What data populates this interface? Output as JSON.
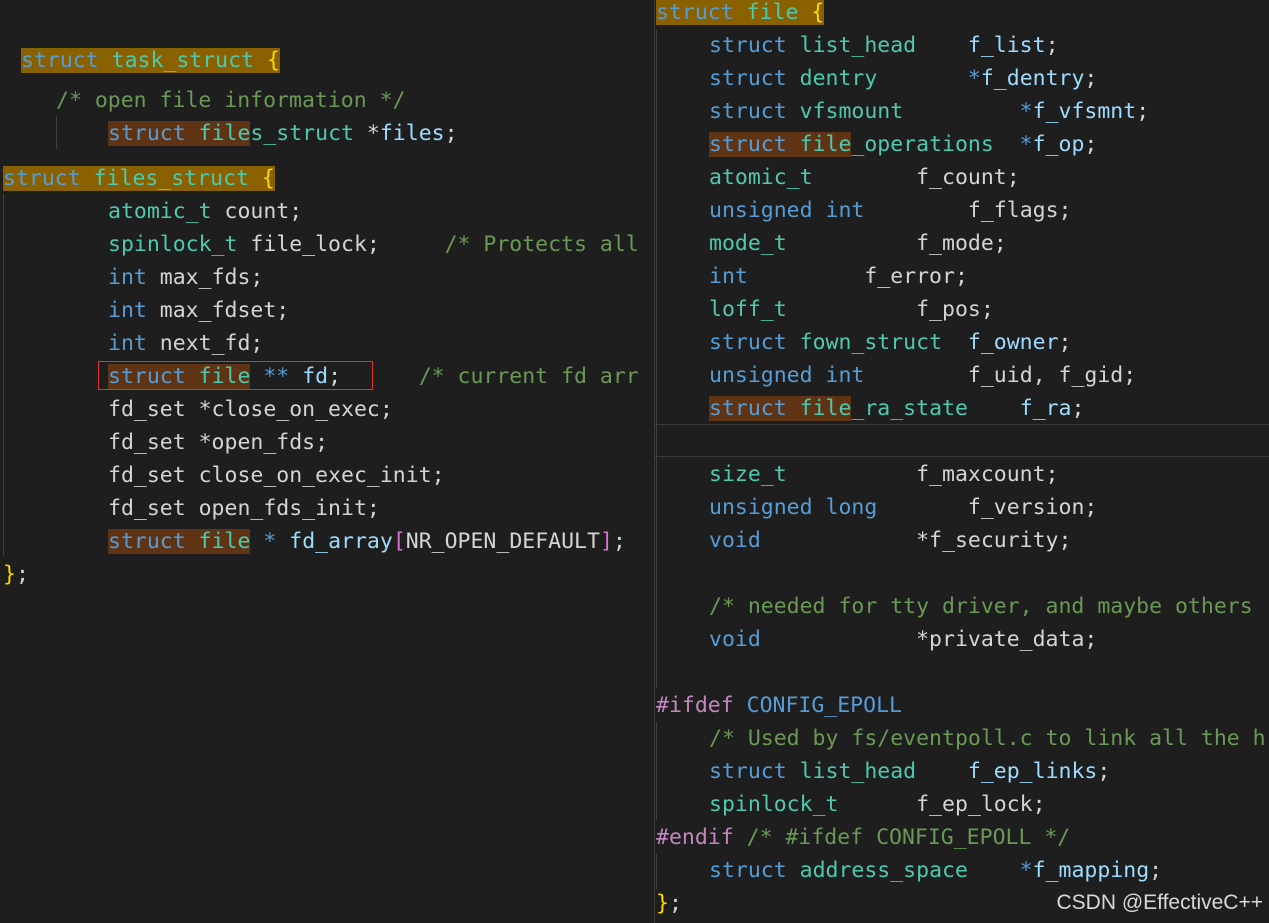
{
  "colors": {
    "background": "#1e1e1e",
    "kw": "#569cd6",
    "type": "#4ec9b0",
    "var": "#9cdcfe",
    "plain": "#d4d4d4",
    "comment": "#6a9955",
    "pre": "#c586c0",
    "brace": "#ffd700",
    "bracket": "#da70d6"
  },
  "watermark": "CSDN @EffectiveC++",
  "left_pane": {
    "lines": [
      {
        "tokens": [
          {
            "t": "struct",
            "c": "kw",
            "hl": "brace"
          },
          {
            "t": " ",
            "c": "plain",
            "hl": "brace"
          },
          {
            "t": "task_struct",
            "c": "type",
            "hl": "brace"
          },
          {
            "t": " ",
            "c": "plain",
            "hl": "brace"
          },
          {
            "t": "{",
            "c": "brace",
            "hl": "brace"
          }
        ]
      },
      {
        "tokens": [
          {
            "t": "/* open file information */",
            "c": "comment"
          }
        ]
      },
      {
        "tokens": [
          {
            "t": "struct",
            "c": "kw",
            "hl": "brown"
          },
          {
            "t": " ",
            "c": "plain",
            "hl": "brown"
          },
          {
            "t": "file",
            "c": "type",
            "hl": "brown"
          },
          {
            "t": "s_struct",
            "c": "type"
          },
          {
            "t": " *",
            "c": "plain"
          },
          {
            "t": "files",
            "c": "var"
          },
          {
            "t": ";",
            "c": "plain"
          }
        ]
      },
      {
        "tokens": [
          {
            "t": "struct",
            "c": "kw",
            "hl": "brace"
          },
          {
            "t": " ",
            "c": "plain",
            "hl": "brace"
          },
          {
            "t": "files_struct",
            "c": "type",
            "hl": "brace"
          },
          {
            "t": " ",
            "c": "plain",
            "hl": "brace"
          },
          {
            "t": "{",
            "c": "brace",
            "hl": "brace"
          }
        ]
      },
      {
        "tokens": [
          {
            "t": "atomic_t",
            "c": "type"
          },
          {
            "t": " count;",
            "c": "plain"
          }
        ]
      },
      {
        "tokens": [
          {
            "t": "spinlock_t",
            "c": "type"
          },
          {
            "t": " file_lock;     ",
            "c": "plain"
          },
          {
            "t": "/* Protects all",
            "c": "comment"
          }
        ]
      },
      {
        "tokens": [
          {
            "t": "int",
            "c": "kw"
          },
          {
            "t": " max_fds;",
            "c": "plain"
          }
        ]
      },
      {
        "tokens": [
          {
            "t": "int",
            "c": "kw"
          },
          {
            "t": " max_fdset;",
            "c": "plain"
          }
        ]
      },
      {
        "tokens": [
          {
            "t": "int",
            "c": "kw"
          },
          {
            "t": " next_fd;",
            "c": "plain"
          }
        ]
      },
      {
        "tokens": [
          {
            "t": "struct",
            "c": "kw",
            "hl": "brown"
          },
          {
            "t": " ",
            "c": "plain",
            "hl": "brown"
          },
          {
            "t": "file",
            "c": "type",
            "hl": "brown"
          },
          {
            "t": " ** ",
            "c": "kw"
          },
          {
            "t": "fd",
            "c": "var"
          },
          {
            "t": ";      ",
            "c": "plain"
          },
          {
            "t": "/* current fd arr",
            "c": "comment"
          }
        ]
      },
      {
        "tokens": [
          {
            "t": "fd_set *close_on_exec;",
            "c": "plain"
          }
        ]
      },
      {
        "tokens": [
          {
            "t": "fd_set *open_fds;",
            "c": "plain"
          }
        ]
      },
      {
        "tokens": [
          {
            "t": "fd_set close_on_exec_init;",
            "c": "plain"
          }
        ]
      },
      {
        "tokens": [
          {
            "t": "fd_set open_fds_init;",
            "c": "plain"
          }
        ]
      },
      {
        "tokens": [
          {
            "t": "struct",
            "c": "kw",
            "hl": "brown"
          },
          {
            "t": " ",
            "c": "plain",
            "hl": "brown"
          },
          {
            "t": "file",
            "c": "type",
            "hl": "brown"
          },
          {
            "t": " * ",
            "c": "kw"
          },
          {
            "t": "fd_array",
            "c": "var"
          },
          {
            "t": "[",
            "c": "bracket"
          },
          {
            "t": "NR_OPEN_DEFAULT",
            "c": "plain"
          },
          {
            "t": "]",
            "c": "bracket"
          },
          {
            "t": ";",
            "c": "plain"
          }
        ]
      },
      {
        "tokens": [
          {
            "t": "}",
            "c": "brace"
          },
          {
            "t": ";",
            "c": "plain"
          }
        ]
      }
    ]
  },
  "right_pane": {
    "lines": [
      {
        "tokens": [
          {
            "t": "struct",
            "c": "kw",
            "hl": "brace"
          },
          {
            "t": " ",
            "c": "plain",
            "hl": "brace"
          },
          {
            "t": "file",
            "c": "type",
            "hl": "brace"
          },
          {
            "t": " ",
            "c": "plain",
            "hl": "brace"
          },
          {
            "t": "{",
            "c": "brace",
            "hl": "brace"
          }
        ]
      },
      {
        "tokens": [
          {
            "t": "struct",
            "c": "kw"
          },
          {
            "t": " ",
            "c": "plain"
          },
          {
            "t": "list_head",
            "c": "type"
          },
          {
            "t": "    ",
            "c": "plain"
          },
          {
            "t": "f_list",
            "c": "var"
          },
          {
            "t": ";",
            "c": "plain"
          }
        ]
      },
      {
        "tokens": [
          {
            "t": "struct",
            "c": "kw"
          },
          {
            "t": " ",
            "c": "plain"
          },
          {
            "t": "dentry",
            "c": "type"
          },
          {
            "t": "       *",
            "c": "kw"
          },
          {
            "t": "f_dentry",
            "c": "var"
          },
          {
            "t": ";",
            "c": "plain"
          }
        ]
      },
      {
        "tokens": [
          {
            "t": "struct",
            "c": "kw"
          },
          {
            "t": " ",
            "c": "plain"
          },
          {
            "t": "vfsmount",
            "c": "type"
          },
          {
            "t": "         *",
            "c": "kw"
          },
          {
            "t": "f_vfsmnt",
            "c": "var"
          },
          {
            "t": ";",
            "c": "plain"
          }
        ]
      },
      {
        "tokens": [
          {
            "t": "struct",
            "c": "kw",
            "hl": "brown"
          },
          {
            "t": " ",
            "c": "plain",
            "hl": "brown"
          },
          {
            "t": "file",
            "c": "type",
            "hl": "brown"
          },
          {
            "t": "_operations",
            "c": "type"
          },
          {
            "t": "  *",
            "c": "kw"
          },
          {
            "t": "f_op",
            "c": "var"
          },
          {
            "t": ";",
            "c": "plain"
          }
        ]
      },
      {
        "tokens": [
          {
            "t": "atomic_t",
            "c": "type"
          },
          {
            "t": "        f_count;",
            "c": "plain"
          }
        ]
      },
      {
        "tokens": [
          {
            "t": "unsigned",
            "c": "kw"
          },
          {
            "t": " ",
            "c": "plain"
          },
          {
            "t": "int",
            "c": "kw"
          },
          {
            "t": "        f_flags;",
            "c": "plain"
          }
        ]
      },
      {
        "tokens": [
          {
            "t": "mode_t",
            "c": "type"
          },
          {
            "t": "          f_mode;",
            "c": "plain"
          }
        ]
      },
      {
        "tokens": [
          {
            "t": "int",
            "c": "kw"
          },
          {
            "t": "         f_error;",
            "c": "plain"
          }
        ]
      },
      {
        "tokens": [
          {
            "t": "loff_t",
            "c": "type"
          },
          {
            "t": "          f_pos;",
            "c": "plain"
          }
        ]
      },
      {
        "tokens": [
          {
            "t": "struct",
            "c": "kw"
          },
          {
            "t": " ",
            "c": "plain"
          },
          {
            "t": "fown_struct",
            "c": "type"
          },
          {
            "t": "  ",
            "c": "plain"
          },
          {
            "t": "f_owner",
            "c": "var"
          },
          {
            "t": ";",
            "c": "plain"
          }
        ]
      },
      {
        "tokens": [
          {
            "t": "unsigned",
            "c": "kw"
          },
          {
            "t": " ",
            "c": "plain"
          },
          {
            "t": "int",
            "c": "kw"
          },
          {
            "t": "        f_uid, f_gid;",
            "c": "plain"
          }
        ]
      },
      {
        "tokens": [
          {
            "t": "struct",
            "c": "kw",
            "hl": "brown"
          },
          {
            "t": " ",
            "c": "plain",
            "hl": "brown"
          },
          {
            "t": "file",
            "c": "type",
            "hl": "brown"
          },
          {
            "t": "_ra_state",
            "c": "type"
          },
          {
            "t": "    ",
            "c": "plain"
          },
          {
            "t": "f_ra",
            "c": "var"
          },
          {
            "t": ";",
            "c": "plain"
          }
        ]
      },
      {
        "tokens": []
      },
      {
        "tokens": [
          {
            "t": "size_t",
            "c": "type"
          },
          {
            "t": "          f_maxcount;",
            "c": "plain"
          }
        ]
      },
      {
        "tokens": [
          {
            "t": "unsigned",
            "c": "kw"
          },
          {
            "t": " ",
            "c": "plain"
          },
          {
            "t": "long",
            "c": "kw"
          },
          {
            "t": "       f_version;",
            "c": "plain"
          }
        ]
      },
      {
        "tokens": [
          {
            "t": "void",
            "c": "kw"
          },
          {
            "t": "            *f_security;",
            "c": "plain"
          }
        ]
      },
      {
        "tokens": []
      },
      {
        "tokens": [
          {
            "t": "/* needed for tty driver, and maybe others",
            "c": "comment"
          }
        ]
      },
      {
        "tokens": [
          {
            "t": "void",
            "c": "kw"
          },
          {
            "t": "            *private_data;",
            "c": "plain"
          }
        ]
      },
      {
        "tokens": []
      },
      {
        "tokens": [
          {
            "t": "#ifdef",
            "c": "pre"
          },
          {
            "t": " ",
            "c": "plain"
          },
          {
            "t": "CONFIG_EPOLL",
            "c": "kw"
          }
        ]
      },
      {
        "tokens": [
          {
            "t": "/* Used by fs/eventpoll.c to link all the h",
            "c": "comment"
          }
        ]
      },
      {
        "tokens": [
          {
            "t": "struct",
            "c": "kw"
          },
          {
            "t": " ",
            "c": "plain"
          },
          {
            "t": "list_head",
            "c": "type"
          },
          {
            "t": "    ",
            "c": "plain"
          },
          {
            "t": "f_ep_links",
            "c": "var"
          },
          {
            "t": ";",
            "c": "plain"
          }
        ]
      },
      {
        "tokens": [
          {
            "t": "spinlock_t",
            "c": "type"
          },
          {
            "t": "      f_ep_lock;",
            "c": "plain"
          }
        ]
      },
      {
        "tokens": [
          {
            "t": "#endif",
            "c": "pre"
          },
          {
            "t": " ",
            "c": "plain"
          },
          {
            "t": "/* #ifdef CONFIG_EPOLL */",
            "c": "comment"
          }
        ]
      },
      {
        "tokens": [
          {
            "t": "struct",
            "c": "kw"
          },
          {
            "t": " ",
            "c": "plain"
          },
          {
            "t": "address_space",
            "c": "type"
          },
          {
            "t": "    *",
            "c": "kw"
          },
          {
            "t": "f_mapping",
            "c": "var"
          },
          {
            "t": ";",
            "c": "plain"
          }
        ]
      },
      {
        "tokens": [
          {
            "t": "}",
            "c": "brace"
          },
          {
            "t": ";",
            "c": "plain"
          }
        ]
      }
    ]
  }
}
